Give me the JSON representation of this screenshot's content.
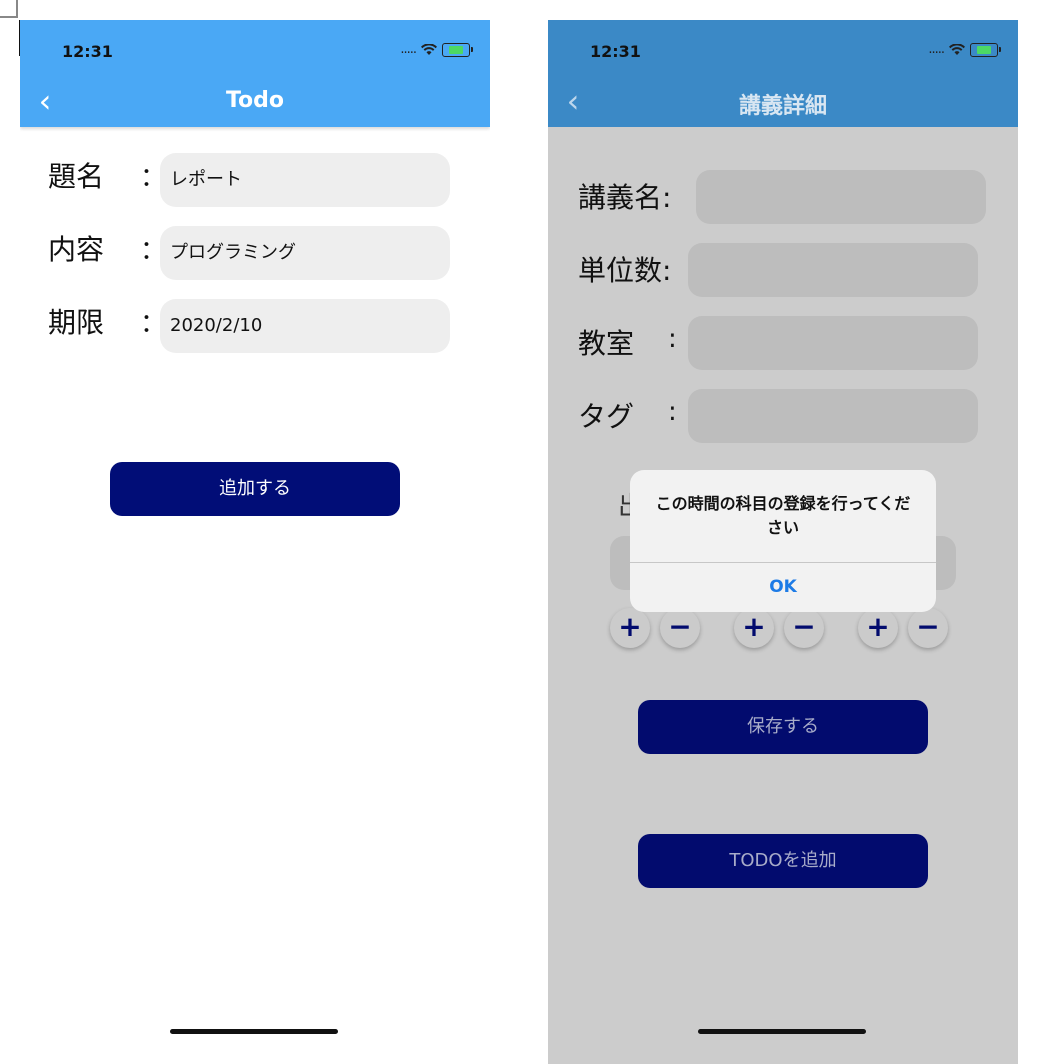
{
  "left_screen": {
    "status_time": "12:31",
    "status_signal": ".....",
    "wifi_icon": "wifi-icon",
    "nav_back_icon": "chevron-left-icon",
    "nav_back_glyph": "‹",
    "nav_title": "Todo",
    "colors": {
      "nav_bg": "#4aa8f5",
      "button_bg": "#010d77",
      "field_bg": "#eeeeee"
    },
    "fields": [
      {
        "label": "題名",
        "colon": "：",
        "value": "レポート"
      },
      {
        "label": "内容",
        "colon": "：",
        "value": "プログラミング"
      },
      {
        "label": "期限",
        "colon": "：",
        "value": "2020/2/10"
      }
    ],
    "add_button_label": "追加する"
  },
  "right_screen": {
    "status_time": "12:31",
    "status_signal": ".....",
    "nav_back_glyph": "‹",
    "nav_title": "講義詳細",
    "colors": {
      "nav_bg": "#3b89c6",
      "screen_dim_bg": "#cccccc",
      "button_bg": "#020b6e",
      "alert_ok": "#1d7be6"
    },
    "fields": [
      {
        "label": "講義名:",
        "colon": ""
      },
      {
        "label": "単位数:",
        "colon": ""
      },
      {
        "label": "教室",
        "colon": ":"
      },
      {
        "label": "タグ",
        "colon": ":"
      }
    ],
    "partial_label_fragment": "出",
    "stepper_plus": "+",
    "stepper_minus": "−",
    "save_button_label": "保存する",
    "todo_button_label": "TODOを追加",
    "alert": {
      "message": "この時間の科目の登録を行ってください",
      "ok_label": "OK"
    }
  }
}
